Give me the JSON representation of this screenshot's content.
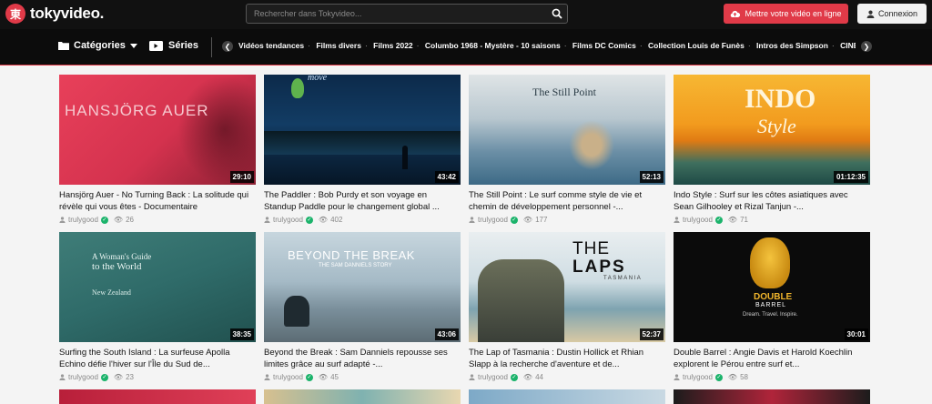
{
  "header": {
    "logo_glyph": "東",
    "logo_text": "tokyvideo.",
    "search_placeholder": "Rechercher dans Tokyvideo...",
    "upload_label": "Mettre votre vidéo en ligne",
    "login_label": "Connexion"
  },
  "nav": {
    "categories_label": "Catégories",
    "series_label": "Séries",
    "tags": [
      "Vidéos tendances",
      "Films divers",
      "Films 2022",
      "Columbo 1968 - Mystère - 10 saisons",
      "Films DC Comics",
      "Collection Louis de Funès",
      "Intros des Simpson",
      "CINÉ"
    ]
  },
  "videos": [
    {
      "title": "Hansjörg Auer - No Turning Back : La solitude qui révèle qui vous êtes - Documentaire",
      "duration": "29:10",
      "user": "trulygood",
      "views": "26",
      "thumb_text": "HANSJÖRG AUER"
    },
    {
      "title": "The Paddler : Bob Purdy et son voyage en Standup Paddle pour le changement global ...",
      "duration": "43:42",
      "user": "trulygood",
      "views": "402",
      "thumb_text": "move"
    },
    {
      "title": "The Still Point : Le surf comme style de vie et chemin de développement personnel -...",
      "duration": "52:13",
      "user": "trulygood",
      "views": "177",
      "thumb_text": "The Still Point"
    },
    {
      "title": "Indo Style : Surf sur les côtes asiatiques avec Sean Gilhooley et Rizal Tanjun -...",
      "duration": "01:12:35",
      "user": "trulygood",
      "views": "71",
      "thumb_text": "INDO",
      "thumb_text2": "Style"
    },
    {
      "title": "Surfing the South Island : La surfeuse Apolla Echino défie l'hiver sur l'Île du Sud de...",
      "duration": "38:35",
      "user": "trulygood",
      "views": "23",
      "thumb_text": "A Woman's Guide",
      "thumb_text2": "to the World",
      "thumb_text3": "New Zealand"
    },
    {
      "title": "Beyond the Break : Sam Danniels repousse ses limites grâce au surf adapté -...",
      "duration": "43:06",
      "user": "trulygood",
      "views": "45",
      "thumb_text": "BEYOND THE BREAK",
      "thumb_text2": "THE SAM DANNIELS STORY"
    },
    {
      "title": "The Lap of Tasmania : Dustin Hollick et Rhian Slapp à la recherche d'aventure et de...",
      "duration": "52:37",
      "user": "trulygood",
      "views": "44",
      "thumb_text": "THE",
      "thumb_text2": "LAPS",
      "thumb_text3": "TASMANIA"
    },
    {
      "title": "Double Barrel : Angie Davis et Harold Koechlin explorent le Pérou entre surf et...",
      "duration": "30:01",
      "user": "trulygood",
      "views": "58",
      "thumb_text": "DOUBLE",
      "thumb_text2": "BARREL",
      "thumb_text3": "Dream. Travel. Inspire."
    }
  ],
  "colors": {
    "accent": "#e03a48",
    "verified": "#1bb36b"
  }
}
